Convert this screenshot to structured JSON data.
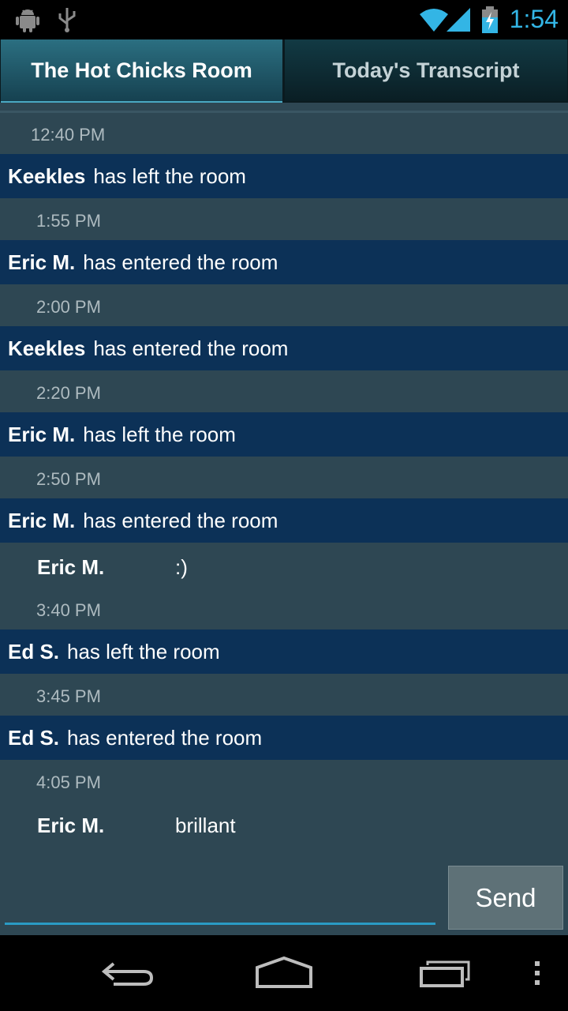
{
  "status_bar": {
    "time": "1:54",
    "left_icons": [
      "android-debug-icon",
      "usb-icon"
    ],
    "right_icons": [
      "wifi-icon",
      "cell-signal-icon",
      "battery-charging-icon"
    ],
    "accent_color": "#33b5e5"
  },
  "tabs": [
    {
      "label": "The Hot Chicks Room",
      "active": true
    },
    {
      "label": "Today's Transcript",
      "active": false
    }
  ],
  "transcript": {
    "ts_1240": "12:40 PM",
    "ev_keekles_left": {
      "name": "Keekles",
      "action": "has left the room"
    },
    "ts_155": "1:55 PM",
    "ev_eric_entered_1": {
      "name": "Eric M.",
      "action": "has entered the room"
    },
    "ts_200": "2:00 PM",
    "ev_keekles_entered": {
      "name": "Keekles",
      "action": "has entered the room"
    },
    "ts_220": "2:20 PM",
    "ev_eric_left": {
      "name": "Eric M.",
      "action": "has left the room"
    },
    "ts_250": "2:50 PM",
    "ev_eric_entered_2": {
      "name": "Eric M.",
      "action": "has entered the room"
    },
    "msg_eric_1": {
      "name": "Eric M.",
      "text": ":)"
    },
    "ts_340": "3:40 PM",
    "ev_ed_left": {
      "name": "Ed S.",
      "action": "has left the room"
    },
    "ts_345": "3:45 PM",
    "ev_ed_entered": {
      "name": "Ed S.",
      "action": "has entered the room"
    },
    "ts_405": "4:05 PM",
    "msg_eric_2": {
      "name": "Eric M.",
      "text": "brillant"
    }
  },
  "compose": {
    "input_value": "",
    "send_label": "Send"
  },
  "nav_bar": {
    "icons": [
      "back-icon",
      "home-icon",
      "recent-apps-icon",
      "overflow-menu-icon"
    ]
  }
}
